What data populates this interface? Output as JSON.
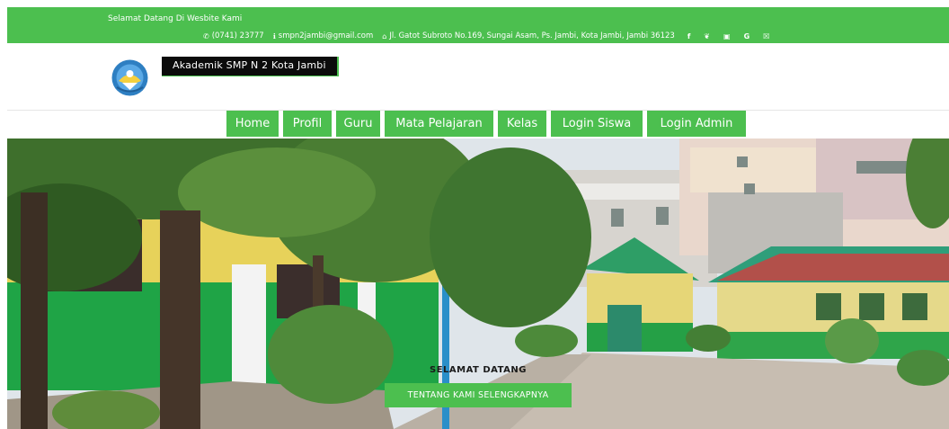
{
  "topbar": {
    "welcome": "Selamat Datang Di Wesbite Kami",
    "phone": "(0741) 23777",
    "email": "smpn2jambi@gmail.com",
    "address": "Jl. Gatot Subroto No.169, Sungai Asam, Ps. Jambi, Kota Jambi, Jambi 36123",
    "social": [
      "f",
      "❦",
      "▣",
      "G",
      "☒"
    ]
  },
  "header": {
    "site_title": "Akademik SMP N 2 Kota Jambi"
  },
  "nav": {
    "items": [
      "Home",
      "Profil",
      "Guru",
      "Mata Pelajaran",
      "Kelas",
      "Login Siswa",
      "Login Admin"
    ]
  },
  "hero": {
    "heading": "SELAMAT DATANG",
    "button": "TENTANG KAMI SELENGKAPNYA"
  },
  "colors": {
    "brand_green": "#4cbf4f",
    "title_bg": "#0b0b0b"
  },
  "icons": {
    "phone": "phone-icon",
    "email": "info-icon",
    "address": "home-icon"
  }
}
